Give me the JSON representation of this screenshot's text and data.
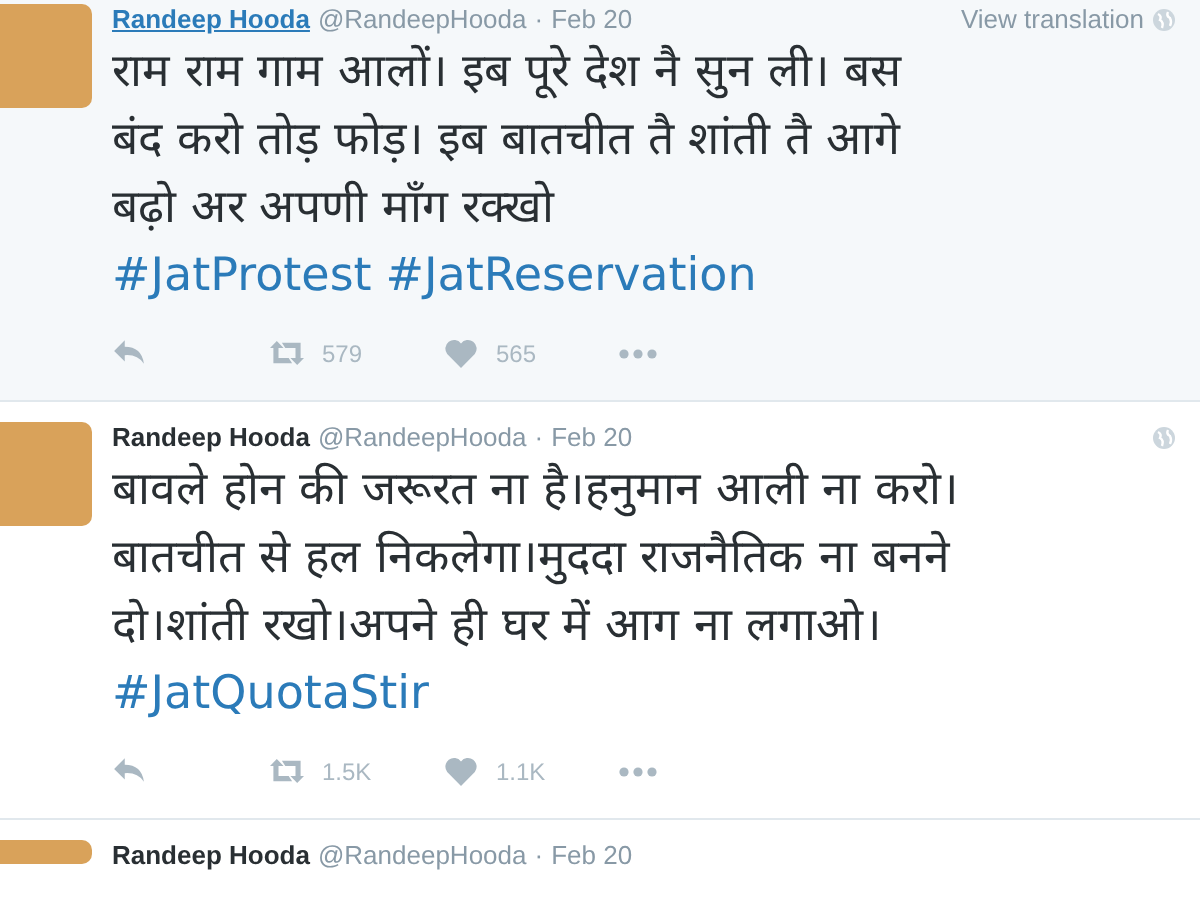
{
  "tweets": [
    {
      "name": "Randeep Hooda",
      "handle": "@RandeepHooda",
      "separator": "·",
      "time": "Feb 20",
      "highlighted": true,
      "translation": "View translation",
      "body": [
        {
          "kind": "text",
          "text": "राम राम गाम आलों। इब पूरे देश नै सुन ली। बस बंद करो तोड़ फोड़। इब बातचीत तै शांती तै आगे बढ़ो अर अपणी माँग रक्खो "
        },
        {
          "kind": "hashtag",
          "text": "#JatProtest"
        },
        {
          "kind": "hashtag",
          "text": "#JatReservation"
        }
      ],
      "retweets": "579",
      "likes": "565"
    },
    {
      "name": "Randeep Hooda",
      "handle": "@RandeepHooda",
      "separator": "·",
      "time": "Feb 20",
      "highlighted": false,
      "body": [
        {
          "kind": "text",
          "text": "बावले होन की जरूरत ना है।हनुमान आली ना करो।बातचीत से हल निकलेगा।मुददा राजनैतिक ना बनने दो।शांती रखो।अपने ही घर में आग ना लगाओ।"
        },
        {
          "kind": "hashtag",
          "text": "#JatQuotaStir"
        }
      ],
      "retweets": "1.5K",
      "likes": "1.1K"
    },
    {
      "name": "Randeep Hooda",
      "handle": "@RandeepHooda",
      "separator": "·",
      "time": "Feb 20",
      "highlighted": false,
      "partial": true
    }
  ]
}
